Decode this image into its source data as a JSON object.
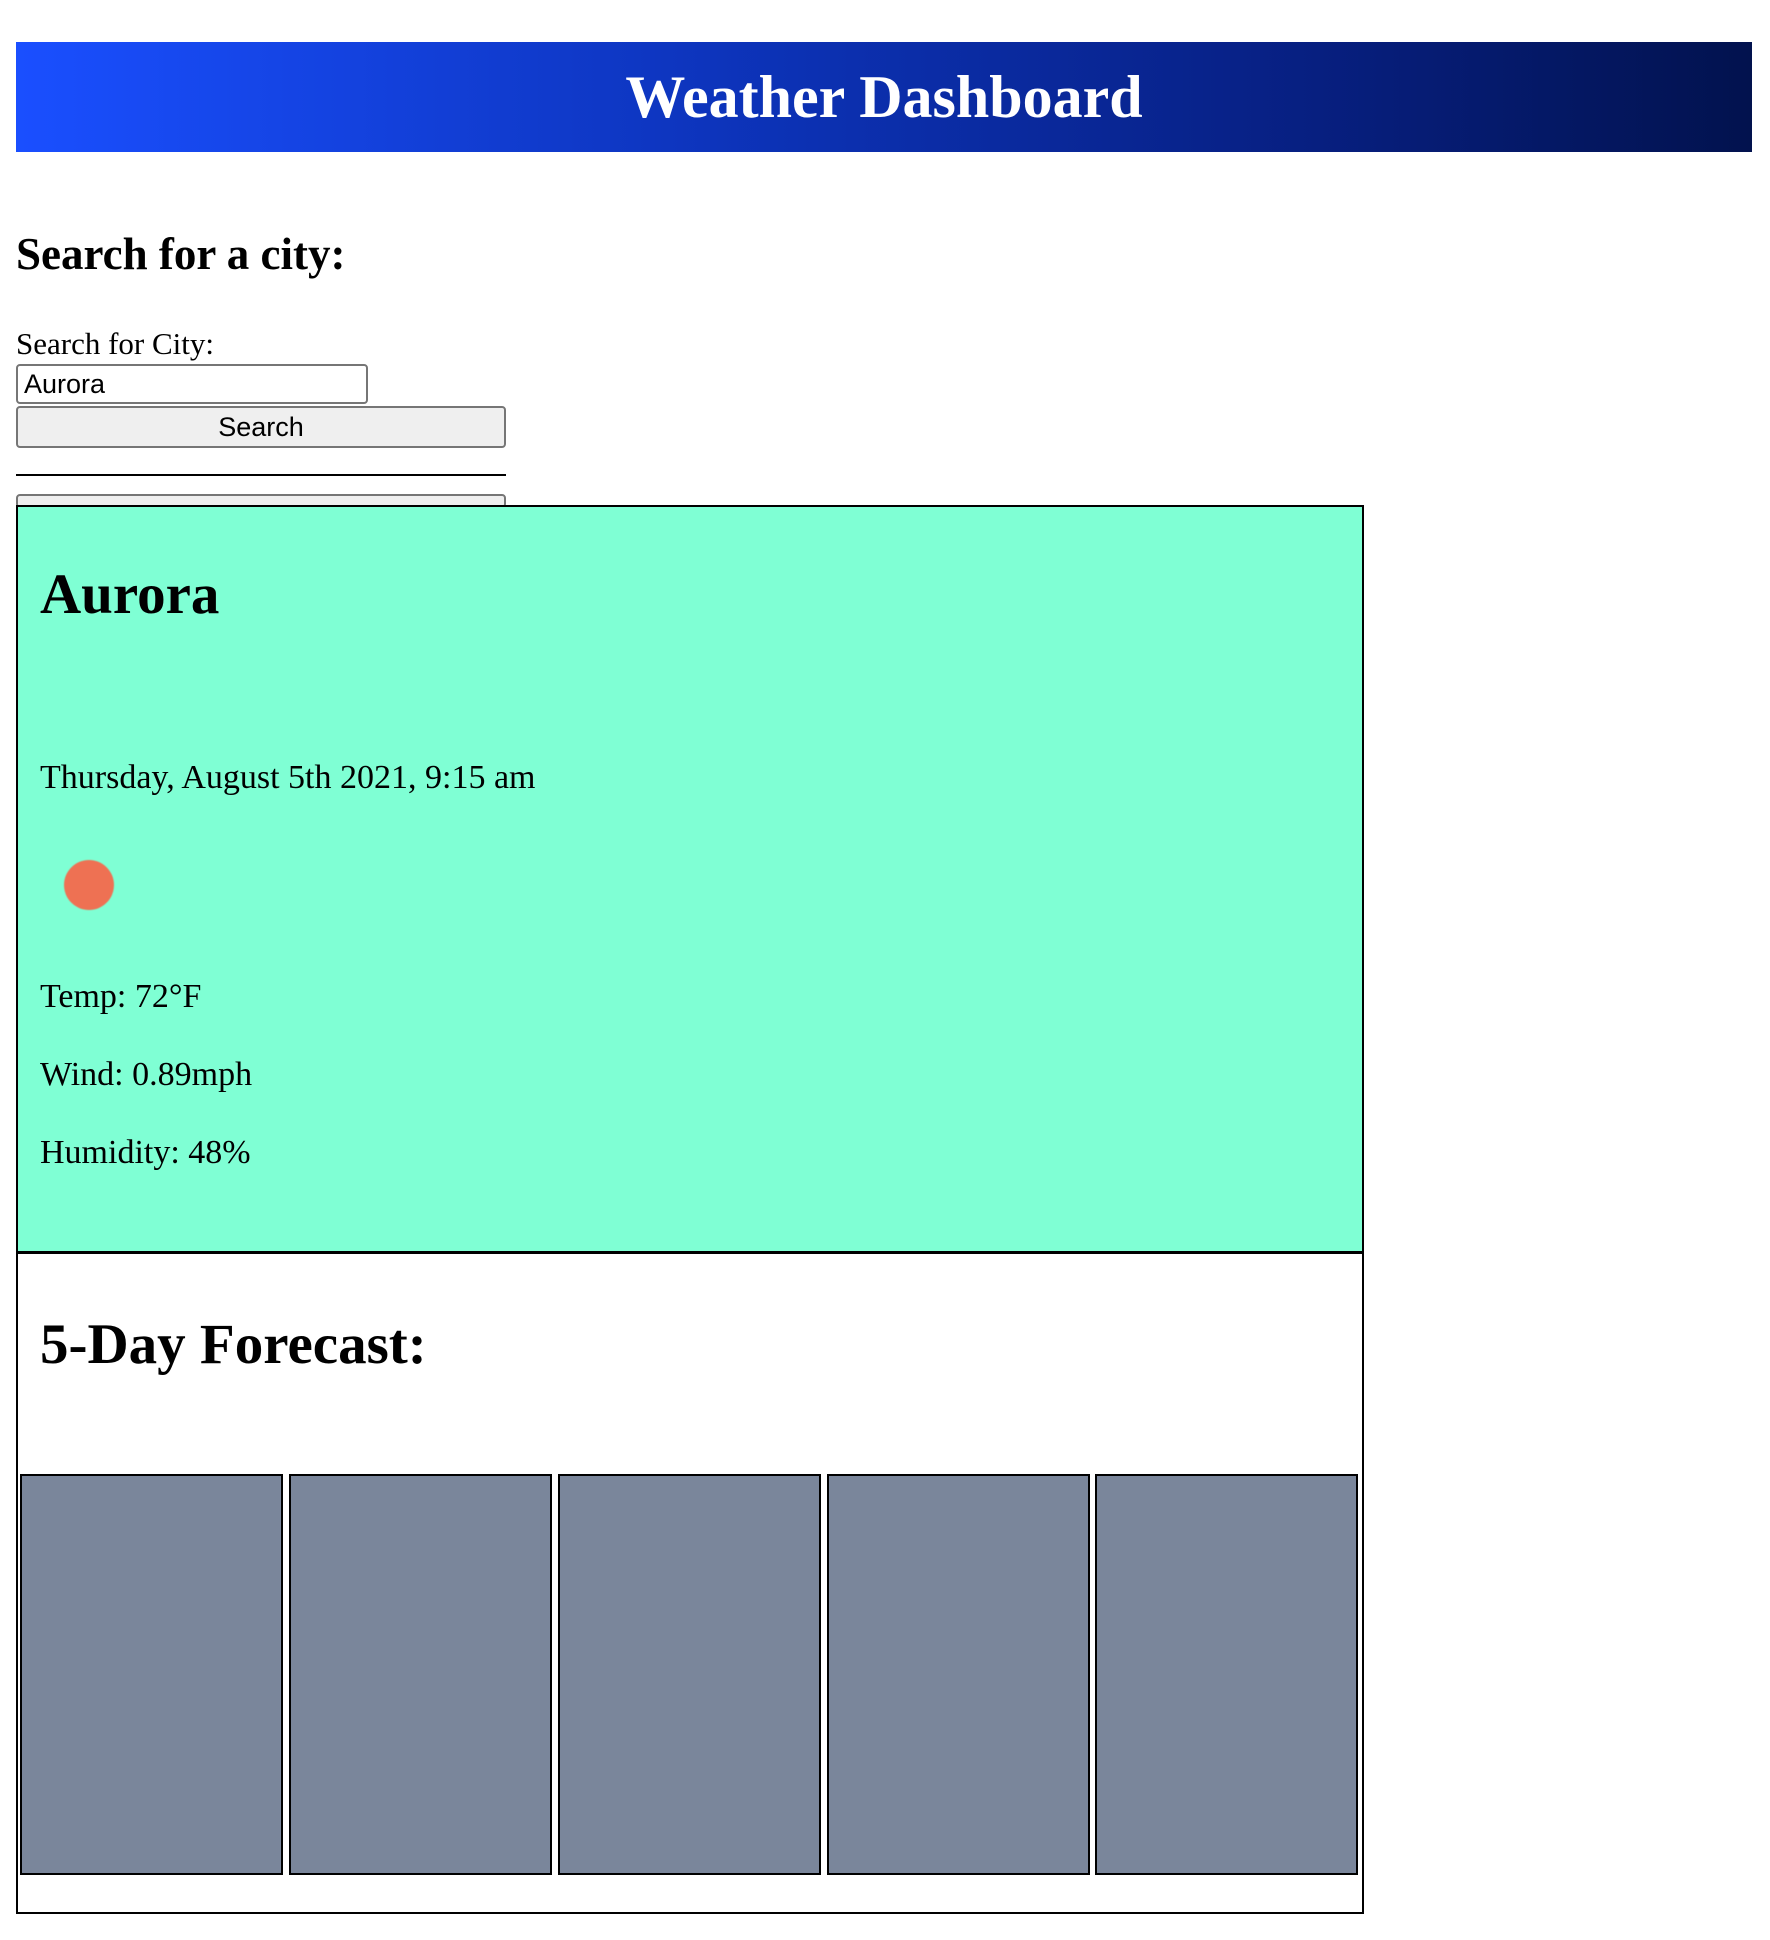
{
  "header": {
    "title": "Weather Dashboard"
  },
  "search": {
    "heading": "Search for a city:",
    "label": "Search for City:",
    "input_value": "Aurora",
    "button_label": "Search"
  },
  "current": {
    "city": "Aurora",
    "datetime": "Thursday, August 5th 2021, 9:15 am",
    "icon": "sun-icon",
    "temp": "Temp: 72°F",
    "wind": "Wind: 0.89mph",
    "humidity": "Humidity: 48%"
  },
  "forecast": {
    "title": "5-Day Forecast:",
    "card_count": 5
  },
  "colors": {
    "header_gradient_start": "#1a4fff",
    "header_gradient_end": "#02124e",
    "current_card_bg": "#7fffd4",
    "forecast_card_bg": "#7a869b",
    "icon_color": "#ee7153"
  }
}
